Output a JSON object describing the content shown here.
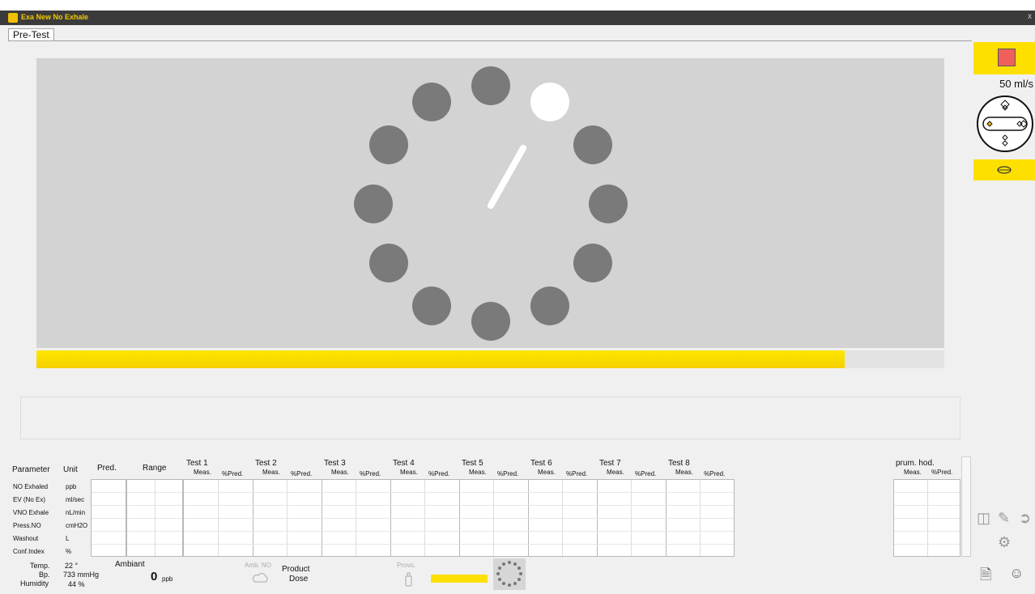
{
  "window": {
    "title": "Exa New No Exhale",
    "close_glyph": "x"
  },
  "tabs": [
    {
      "label": "Pre-Test"
    }
  ],
  "progress": {
    "fraction": 0.89
  },
  "sidebar": {
    "flow_rate": "50 ml/s"
  },
  "colors": {
    "accent": "#fde000",
    "stop": "#f0605a",
    "dot": "#7a7a7a",
    "stage": "#d3d3d3"
  },
  "table": {
    "headers": {
      "parameter": "Parameter",
      "unit": "Unit",
      "pred": "Pred.",
      "range": "Range",
      "avg": "prum. hod."
    },
    "sub": {
      "meas": "Meas.",
      "pred": "%Pred."
    },
    "tests": [
      "Test 1",
      "Test 2",
      "Test 3",
      "Test 4",
      "Test 5",
      "Test 6",
      "Test 7",
      "Test 8"
    ],
    "rows": [
      {
        "label": "NO Exhaled",
        "unit": "ppb"
      },
      {
        "label": "EV (No Ex)",
        "unit": "ml/sec"
      },
      {
        "label": "VNO Exhale",
        "unit": "nL/min"
      },
      {
        "label": "Press.NO",
        "unit": "cmH2O"
      },
      {
        "label": "Washout",
        "unit": "L"
      },
      {
        "label": "Conf.Index",
        "unit": "%"
      }
    ]
  },
  "status": {
    "temp_label": "Temp.",
    "temp_value": "22 °",
    "bp_label": "Bp.",
    "bp_value": "733 mmHg",
    "humidity_label": "Humidity",
    "humidity_value": "44 %",
    "ambiant_label": "Ambiant",
    "no_value": "0",
    "no_unit": "ppb",
    "amb_no_label": "Amb. NO",
    "product_label": "Product",
    "dose_label": "Dose",
    "provo_label": "Provo."
  },
  "icons": [
    "app-icon",
    "stop-icon",
    "gauge-icon",
    "mouth-icon",
    "monitor-icon",
    "edit-icon",
    "arrow-icon",
    "settings-icon",
    "report-icon",
    "user-icon",
    "cloud-icon",
    "bottle-icon",
    "mini-dial-icon"
  ]
}
